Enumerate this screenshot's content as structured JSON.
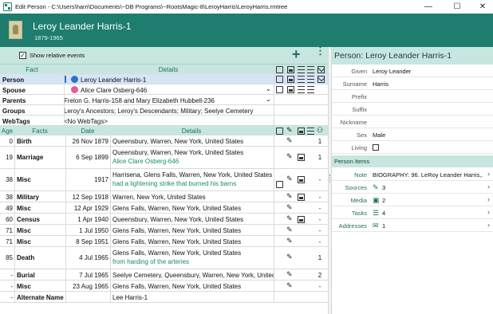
{
  "window": {
    "title": "Edit Person - C:\\Users\\harri\\Documents\\~DB Programs\\~RootsMagic-8\\LeroyHarris\\LeroyHarris.rmtree",
    "controls": {
      "minimize": "—",
      "maximize": "☐",
      "close": "✕"
    }
  },
  "header": {
    "name": "Leroy Leander Harris-1",
    "years": "1879-1965"
  },
  "toolbar": {
    "show_relative_events": "Show relative events",
    "checked": "✓",
    "add": "+",
    "more": "⋮"
  },
  "top_grid": {
    "col_fact": "Fact",
    "col_details": "Details",
    "rows": [
      {
        "fact": "Person",
        "details": "Leroy Leander Harris-1"
      },
      {
        "fact": "Spouse",
        "details": "Alice Clare Osberg-646"
      },
      {
        "fact": "Parents",
        "details": "Frelon G. Harris-158 and Mary Elizabeth Hubbell-236"
      },
      {
        "fact": "Groups",
        "details": "Leroy's Ancestors; Leroy's Descendants; Military; Seelye Cemetery"
      },
      {
        "fact": "WebTags",
        "details": "<No WebTags>"
      }
    ]
  },
  "events_grid": {
    "columns": {
      "age": "Age",
      "facts": "Facts",
      "date": "Date",
      "details": "Details"
    },
    "rows": [
      {
        "age": "0",
        "fact": "Birth",
        "date": "26 Nov 1879",
        "place": "Queensbury, Warren, New York, United States",
        "note": "",
        "src": "1",
        "media": false
      },
      {
        "age": "19",
        "fact": "Marriage",
        "date": "6 Sep 1899",
        "place": "Queensbury, Warren, New York, United States",
        "note": "Alice Clare Osberg-646",
        "src": "1",
        "media": true
      },
      {
        "age": "38",
        "fact": "Misc",
        "date": "1917",
        "place": "Harrisena, Glens Falls, Warren, New York, United States",
        "note": "had a  lightening strike that burned his barns",
        "src": "-",
        "media": true
      },
      {
        "age": "38",
        "fact": "Military",
        "date": "12 Sep 1918",
        "place": "Warren, New York, United States",
        "note": "",
        "src": "-",
        "media": true
      },
      {
        "age": "49",
        "fact": "Misc",
        "date": "12 Apr 1929",
        "place": "Glens Falls, Warren, New York, United States",
        "note": "",
        "src": "-",
        "media": false
      },
      {
        "age": "60",
        "fact": "Census",
        "date": "1 Apr 1940",
        "place": "Queensbury, Warren, New York, United States",
        "note": "",
        "src": "-",
        "media": true
      },
      {
        "age": "71",
        "fact": "Misc",
        "date": "1 Jul 1950",
        "place": "Glens Falls, Warren, New York, United States",
        "note": "",
        "src": "-",
        "media": false
      },
      {
        "age": "71",
        "fact": "Misc",
        "date": "8 Sep 1951",
        "place": "Glens Falls, Warren, New York, United States",
        "note": "",
        "src": "-",
        "media": false
      },
      {
        "age": "85",
        "fact": "Death",
        "date": "4 Jul 1965",
        "place": "Glens Falls, Warren, New York, United States",
        "note": "from harding of the arteries",
        "src": "1",
        "media": false
      },
      {
        "age": "-",
        "fact": "Burial",
        "date": "7 Jul 1965",
        "place": "Seelye Cemetery, Queensbury, Warren, New York, United States",
        "note": "",
        "src": "2",
        "media": false
      },
      {
        "age": "-",
        "fact": "Misc",
        "date": "23 Aug 1965",
        "place": "Glens Falls, Warren, New York, United States",
        "note": "",
        "src": "-",
        "media": false
      },
      {
        "age": "-",
        "fact": "Alternate Name",
        "date": "",
        "place": "Lee Harris-1",
        "note": "",
        "src": "",
        "media": false
      }
    ]
  },
  "right": {
    "title": "Person: Leroy Leander Harris-1",
    "fields": [
      {
        "label": "Given",
        "value": "Leroy Leander"
      },
      {
        "label": "Surname",
        "value": "Harris"
      },
      {
        "label": "Prefix",
        "value": ""
      },
      {
        "label": "Suffix",
        "value": ""
      },
      {
        "label": "Nickname",
        "value": ""
      },
      {
        "label": "Sex",
        "value": "Male"
      },
      {
        "label": "Living",
        "value": ""
      }
    ],
    "items_title": "Person Items",
    "note_label": "Note",
    "note_value": "BIOGRAPHY:      96.  LeRoy Leander Harris,...",
    "items": [
      {
        "label": "Sources",
        "value": "3",
        "icon": "pencil-icon"
      },
      {
        "label": "Media",
        "value": "2",
        "icon": "image-icon"
      },
      {
        "label": "Tasks",
        "value": "4",
        "icon": "tasks-icon"
      },
      {
        "label": "Addresses",
        "value": "1",
        "icon": "mail-icon"
      }
    ]
  }
}
